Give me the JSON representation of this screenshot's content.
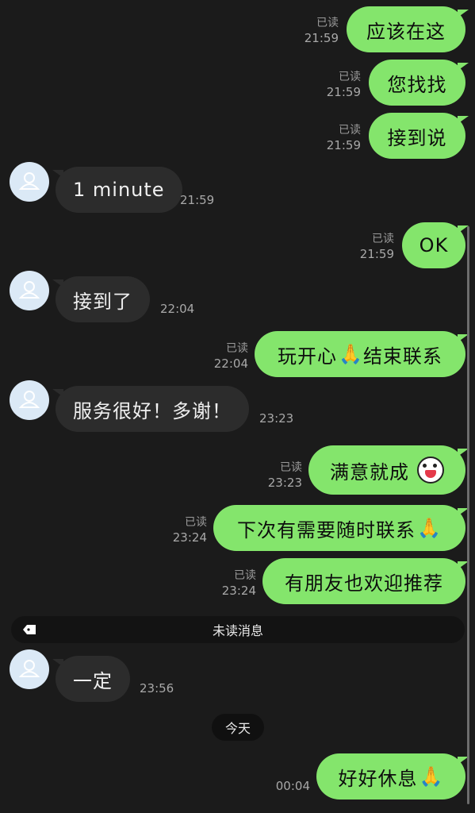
{
  "read_label": "已读",
  "unread_bar_label": "未读消息",
  "date_divider": "今天",
  "messages": [
    {
      "dir": "out",
      "text": "应该在这",
      "time": "21:59",
      "read": "已读"
    },
    {
      "dir": "out",
      "text": "您找找",
      "time": "21:59",
      "read": "已读"
    },
    {
      "dir": "out",
      "text": "接到说",
      "time": "21:59",
      "read": "已读"
    },
    {
      "dir": "in",
      "text": "1 minute",
      "time": "21:59"
    },
    {
      "dir": "out",
      "text": "OK",
      "time": "21:59",
      "read": "已读"
    },
    {
      "dir": "in",
      "text": "接到了",
      "time": "22:04"
    },
    {
      "dir": "out",
      "text": "玩开心",
      "text2": "结束联系",
      "emoji": "🙏",
      "time": "22:04",
      "read": "已读"
    },
    {
      "dir": "in",
      "text": "服务很好！多谢！",
      "time": "23:23"
    },
    {
      "dir": "out",
      "text": "满意就成",
      "emoji_icon": "laughing-crying-face-icon",
      "time": "23:23",
      "read": "已读"
    },
    {
      "dir": "out",
      "text": "下次有需要随时联系",
      "emoji": "🙏",
      "time": "23:24",
      "read": "已读"
    },
    {
      "dir": "out",
      "text": "有朋友也欢迎推荐",
      "time": "23:24",
      "read": "已读"
    },
    {
      "dir": "in",
      "text": "一定",
      "time": "23:56"
    },
    {
      "dir": "out",
      "text": "好好休息",
      "emoji": "🙏",
      "time": "00:04"
    }
  ],
  "colors": {
    "background": "#1b1b1b",
    "outgoing_bubble": "#84e56c",
    "incoming_bubble": "#2c2c2c",
    "avatar": "#dbe9f6"
  }
}
